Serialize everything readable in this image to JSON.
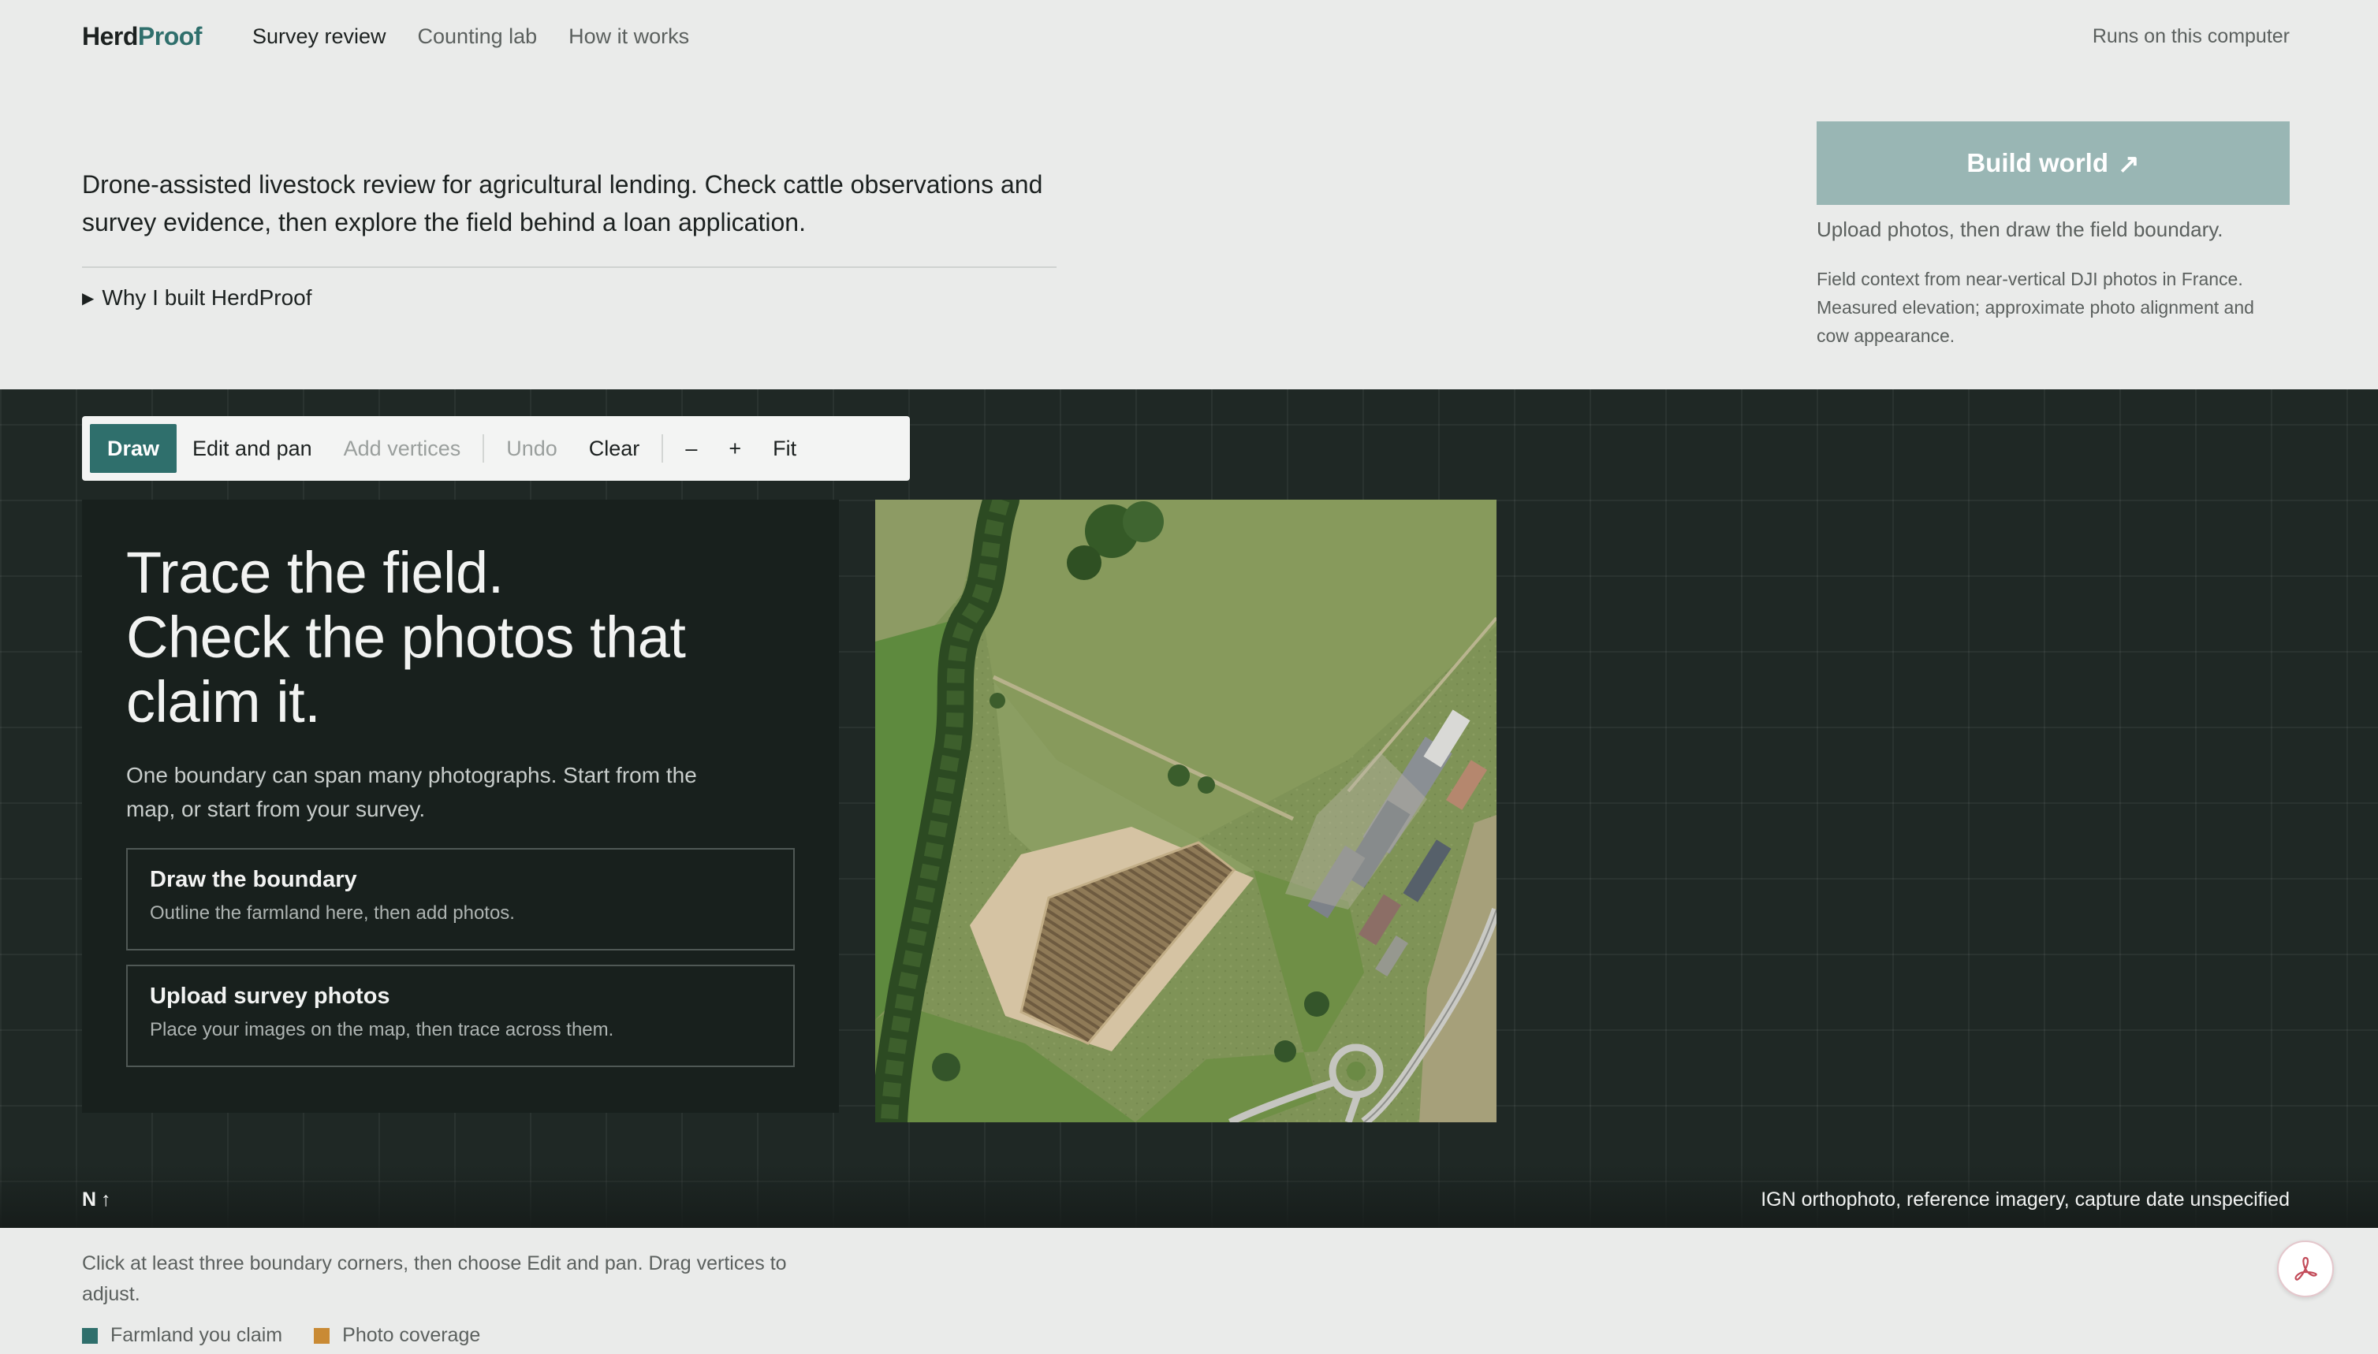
{
  "header": {
    "brand_part1": "Herd",
    "brand_part2": "Proof",
    "nav": [
      "Survey review",
      "Counting lab",
      "How it works"
    ],
    "runs_on": "Runs on this computer"
  },
  "intro": {
    "text": "Drone-assisted livestock review for agricultural lending. Check cattle observations and survey evidence, then explore the field behind a loan application.",
    "why_label": "Why I built HerdProof"
  },
  "build": {
    "label": "Build world",
    "arrow": "↗",
    "hint": "Upload photos, then draw the field boundary.",
    "note": "Field context from near-vertical DJI photos in France. Measured elevation; approximate photo alignment and cow appearance."
  },
  "toolbar": {
    "draw": "Draw",
    "edit_pan": "Edit and pan",
    "add_vertices": "Add vertices",
    "undo": "Undo",
    "clear": "Clear",
    "zoom_out": "–",
    "zoom_in": "+",
    "fit": "Fit"
  },
  "panel": {
    "title_line1": "Trace the field.",
    "title_line2": "Check the photos that",
    "title_line3": "claim it.",
    "subtitle": "One boundary can span many photographs. Start from the map, or start from your survey.",
    "cards": [
      {
        "title": "Draw the boundary",
        "desc": "Outline the farmland here, then add photos."
      },
      {
        "title": "Upload survey photos",
        "desc": "Place your images on the map, then trace across them."
      }
    ]
  },
  "map": {
    "north_label": "N",
    "north_arrow": "↑",
    "credit": "IGN orthophoto, reference imagery, capture date unspecified"
  },
  "footer": {
    "instruction": "Click at least three boundary corners, then choose Edit and pan. Drag vertices to adjust.",
    "legend": [
      {
        "label": "Farmland you claim",
        "color": "#2f6f6c"
      },
      {
        "label": "Photo coverage",
        "color": "#c98a34"
      }
    ]
  },
  "colors": {
    "accent": "#2f6f6c",
    "build_button": "#99b6b4",
    "stage_bg": "#1f2825",
    "panel_bg": "#18201d"
  },
  "icons": [
    "pdf-icon",
    "north-arrow-icon",
    "disclosure-triangle-icon",
    "external-arrow-icon"
  ]
}
